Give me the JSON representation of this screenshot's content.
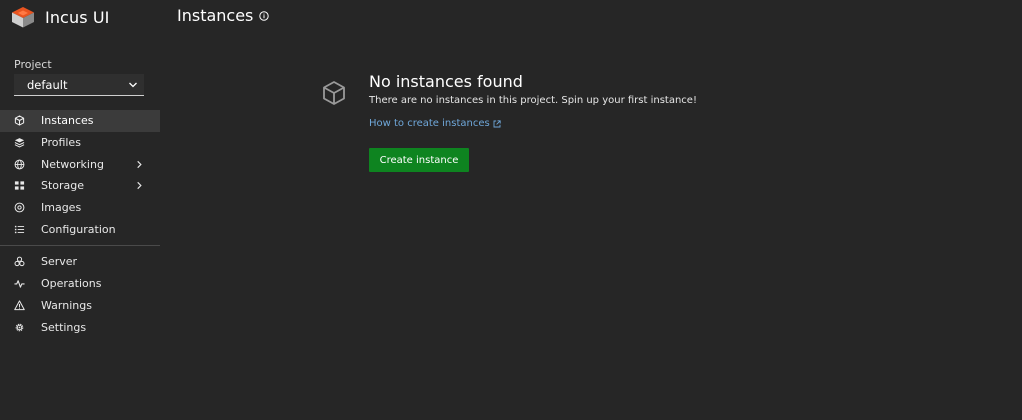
{
  "brand": {
    "name": "Incus UI"
  },
  "project": {
    "label": "Project",
    "selected": "default"
  },
  "nav": {
    "primary": [
      {
        "label": "Instances",
        "icon": "instances-icon",
        "active": true
      },
      {
        "label": "Profiles",
        "icon": "profiles-icon"
      },
      {
        "label": "Networking",
        "icon": "networking-icon",
        "expandable": true
      },
      {
        "label": "Storage",
        "icon": "storage-icon",
        "expandable": true
      },
      {
        "label": "Images",
        "icon": "images-icon"
      },
      {
        "label": "Configuration",
        "icon": "configuration-icon"
      }
    ],
    "secondary": [
      {
        "label": "Server",
        "icon": "server-icon"
      },
      {
        "label": "Operations",
        "icon": "operations-icon"
      },
      {
        "label": "Warnings",
        "icon": "warnings-icon"
      },
      {
        "label": "Settings",
        "icon": "settings-icon"
      }
    ]
  },
  "header": {
    "title": "Instances"
  },
  "empty_state": {
    "title": "No instances found",
    "text": "There are no instances in this project. Spin up your first instance!",
    "link": "How to create instances",
    "button": "Create instance"
  },
  "colors": {
    "background": "#262626",
    "active_nav": "#3b3b3b",
    "primary_button": "#0e8420",
    "link": "#6fa7d9"
  }
}
